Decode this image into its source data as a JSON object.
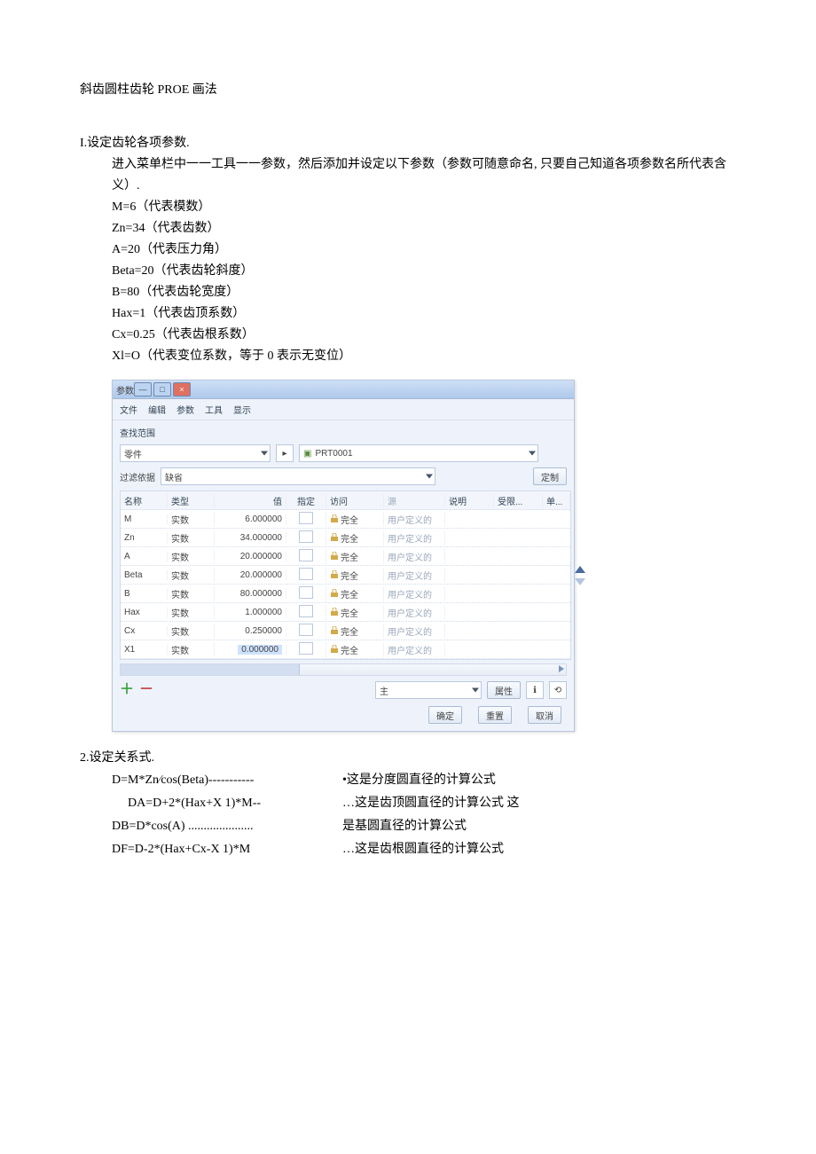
{
  "title": "斜齿圆柱齿轮 PROE 画法",
  "section1": {
    "head": "I.设定齿轮各项参数.",
    "intro": "进入菜单栏中一一工具一一参数，然后添加并设定以下参数（参数可随意命名, 只要自己知道各项参数名所代表含义）.",
    "params": [
      "M=6（代表模数）",
      "Zn=34（代表齿数）",
      "A=20（代表压力角）",
      "Beta=20（代表齿轮斜度）",
      "B=80（代表齿轮宽度）",
      "Hax=1（代表齿顶系数）",
      "Cx=0.25（代表齿根系数）",
      "Xl=O（代表变位系数，等于 0 表示无变位）"
    ]
  },
  "dialog": {
    "window_title": "参数",
    "menu": [
      "文件",
      "编辑",
      "参数",
      "工具",
      "显示"
    ],
    "find_label": "查找范围",
    "scope_value": "零件",
    "model_name": "PRT0001",
    "filter_label": "过滤依据",
    "filter_value": "缺省",
    "custom_btn": "定制",
    "headers": {
      "name": "名称",
      "type": "类型",
      "value": "值",
      "assign": "指定",
      "access": "访问",
      "source": "源",
      "desc": "说明",
      "restrict": "受限...",
      "unit": "单..."
    },
    "type_real": "实数",
    "access_full": "完全",
    "source_user": "用户定义的",
    "rows": [
      {
        "name": "M",
        "value": "6.000000"
      },
      {
        "name": "Zn",
        "value": "34.000000"
      },
      {
        "name": "A",
        "value": "20.000000"
      },
      {
        "name": "Beta",
        "value": "20.000000"
      },
      {
        "name": "B",
        "value": "80.000000"
      },
      {
        "name": "Hax",
        "value": "1.000000"
      },
      {
        "name": "Cx",
        "value": "0.250000"
      },
      {
        "name": "X1",
        "value": "0.000000",
        "selected": true
      }
    ],
    "main_value": "主",
    "props_btn": "属性",
    "ok": "确定",
    "reset": "重置",
    "cancel": "取消"
  },
  "section2": {
    "head": "2.设定关系式.",
    "left": [
      "D=M*Zn⁄cos(Beta)-----------",
      "DA=D+2*(Hax+X 1)*M--",
      "DB=D*cos(A) .....................",
      "DF=D-2*(Hax+Cx-X 1)*M"
    ],
    "right": [
      "•这是分度圆直径的计算公式",
      "…这是齿顶圆直径的计算公式 这",
      "是基圆直径的计算公式",
      "…这是齿根圆直径的计算公式"
    ]
  }
}
